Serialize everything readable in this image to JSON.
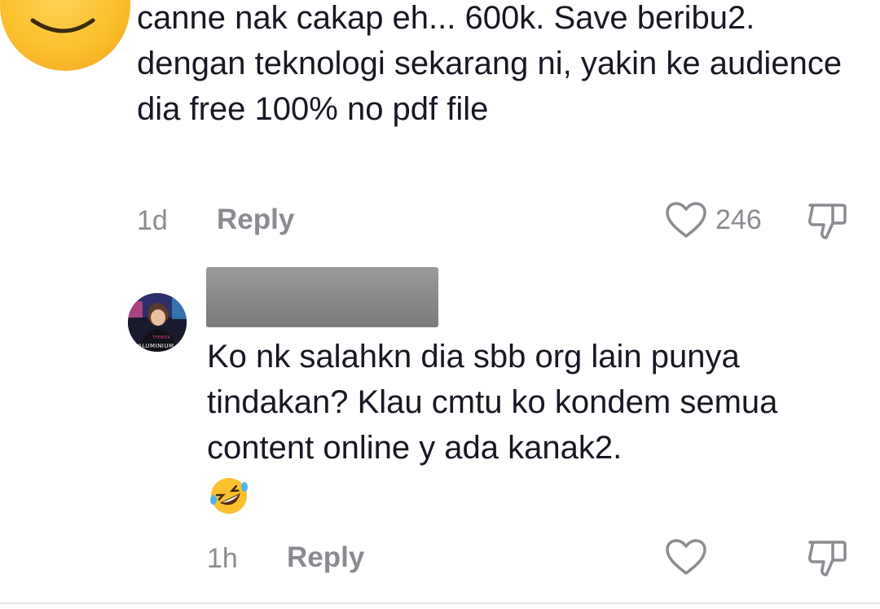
{
  "comment_1": {
    "text": "canne nak cakap eh... 600k. Save beribu2. dengan teknologi sekarang ni, yakin ke audience dia free 100% no pdf file",
    "time": "1d",
    "reply_label": "Reply",
    "like_count": "246",
    "avatar_icon": "smiling-face-emoji-icon"
  },
  "comment_2": {
    "username": "",
    "avatar_label": "ALUMINIUM",
    "text": "Ko nk salahkn dia sbb org lain punya tindakan? Klau cmtu ko kondem semua content online y ada kanak2.",
    "emoji": "rolling-on-the-floor-laughing-emoji-icon",
    "time": "1h",
    "reply_label": "Reply",
    "like_count": ""
  },
  "colors": {
    "text_primary": "#161823",
    "text_secondary": "#8a8b91",
    "background": "#ffffff",
    "redaction": "#8a8a8a"
  }
}
